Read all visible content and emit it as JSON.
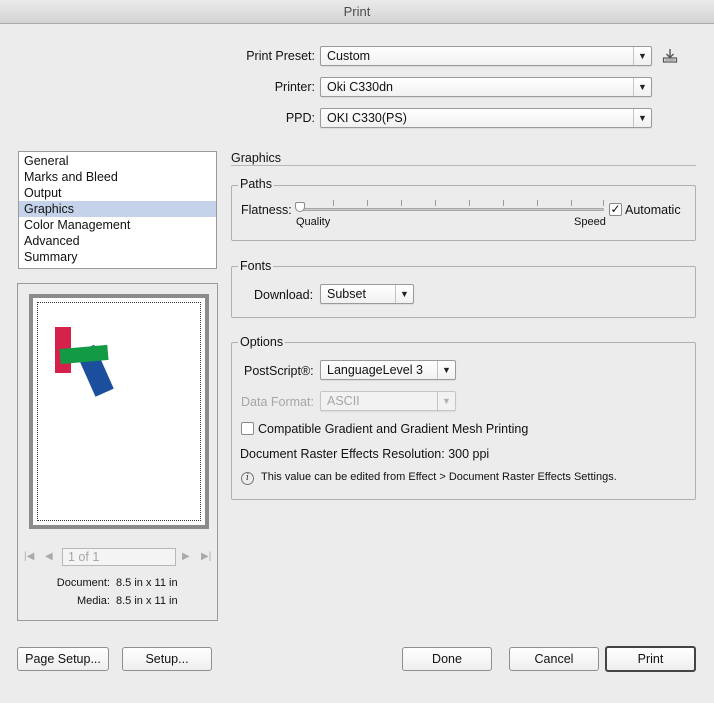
{
  "window": {
    "title": "Print"
  },
  "top": {
    "print_preset": {
      "label": "Print Preset:",
      "value": "Custom"
    },
    "printer": {
      "label": "Printer:",
      "value": "Oki C330dn"
    },
    "ppd": {
      "label": "PPD:",
      "value": "OKI C330(PS)"
    }
  },
  "sidebar": {
    "items": [
      {
        "label": "General"
      },
      {
        "label": "Marks and Bleed"
      },
      {
        "label": "Output"
      },
      {
        "label": "Graphics",
        "selected": true
      },
      {
        "label": "Color Management"
      },
      {
        "label": "Advanced"
      },
      {
        "label": "Summary"
      }
    ]
  },
  "preview": {
    "pager": "1 of 1",
    "document_label": "Document:",
    "document_value": "8.5 in x 11 in",
    "media_label": "Media:",
    "media_value": "8.5 in x 11 in",
    "colors": {
      "red": "#d4224a",
      "green": "#129a45",
      "blue": "#1b4f9e"
    }
  },
  "panel": {
    "heading": "Graphics",
    "paths": {
      "title": "Paths",
      "flatness_label": "Flatness:",
      "quality_label": "Quality",
      "speed_label": "Speed",
      "automatic_label": "Automatic",
      "automatic_checked": true
    },
    "fonts": {
      "title": "Fonts",
      "download_label": "Download:",
      "download_value": "Subset"
    },
    "options": {
      "title": "Options",
      "postscript_label": "PostScript®:",
      "postscript_value": "LanguageLevel 3",
      "data_format_label": "Data Format:",
      "data_format_value": "ASCII",
      "compatible_gradient_label": "Compatible Gradient and Gradient Mesh Printing",
      "compatible_gradient_checked": false,
      "raster_resolution_text": "Document Raster Effects Resolution: 300 ppi",
      "info_text": "This value can be edited from Effect > Document Raster Effects Settings."
    }
  },
  "buttons": {
    "page_setup": "Page Setup...",
    "setup": "Setup...",
    "done": "Done",
    "cancel": "Cancel",
    "print": "Print"
  }
}
